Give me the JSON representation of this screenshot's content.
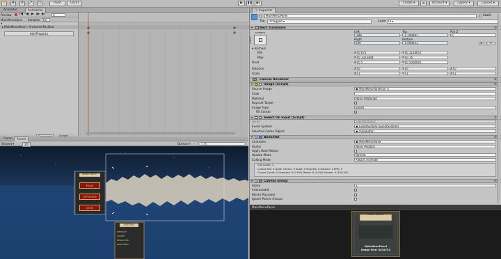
{
  "toolbar": {
    "pivot_label": "Pivot",
    "local_label": "Local",
    "collab_label": "Collab",
    "account_label": "Account",
    "layers_label": "Layers",
    "layout_label": "Layout"
  },
  "animation": {
    "tab_animator": "Animator",
    "tab_animation": "Animation",
    "preview_label": "Preview",
    "frame_value": "0",
    "clip_name": "MainMenuOpen",
    "samples_label": "Samples",
    "samples_value": "60",
    "property_label": "MainMenuPanel : Anchored Position",
    "add_property_label": "Add Property",
    "bottom_tab_dopesheet": "Dopesheet",
    "bottom_tab_curves": "Curves"
  },
  "scene": {
    "tab_game": "Game",
    "tab_scene": "Scene",
    "shaded_label": "Shaded",
    "mode_2d": "2D",
    "gizmos_label": "Gizmos",
    "search_placeholder": "All",
    "menu_title": "MAIN MENU",
    "play_label": "PLAY",
    "options_label": "OPTIONS",
    "quit_label": "QUIT",
    "options_title": "OPTIONS",
    "opt_row1": "DIFFICULTY",
    "opt_row2": "VOLUME",
    "opt_row3": "RESOLUTION",
    "opt_row4": "BRIGHTNESS"
  },
  "inspector": {
    "tab_label": "Inspector",
    "object_name": "MainMenuPanel",
    "static_label": "Static",
    "tag_label": "Tag",
    "tag_value": "Untagged",
    "layer_label": "Layer",
    "layer_value": "UI",
    "rect_transform": {
      "title": "Rect Transform",
      "anchor_label": "custom",
      "side_label": "custom",
      "left_label": "Left",
      "left_value": "-646",
      "top_label": "Top",
      "top_value": "-1.199981",
      "posz_label": "Pos Z",
      "posz_value": "0",
      "right_label": "Right",
      "right_value": "646",
      "bottom_label": "Bottom",
      "bottom_value": "-1.000031",
      "r_button": "R",
      "anchors_label": "Anchors",
      "min_label": "Min",
      "min_x": "0.075",
      "min_y": "0.1124057",
      "max_label": "Max",
      "max_x": "0.3323404",
      "max_y": "0.74",
      "pivot_label": "Pivot",
      "pivot_x": "0.5",
      "pivot_y": "0.5000001",
      "rotation_label": "Rotation",
      "rot_x": "0",
      "rot_y": "0",
      "rot_z": "0",
      "scale_label": "Scale",
      "scale_x": "1",
      "scale_y": "1",
      "scale_z": "1"
    },
    "canvas_renderer": {
      "title": "Canvas Renderer"
    },
    "image": {
      "title": "Image (Script)",
      "source_label": "Source Image",
      "source_value": "MainMenuPanelFull_4",
      "color_label": "Color",
      "material_label": "Material",
      "material_value": "None (Material)",
      "raycast_label": "Raycast Target",
      "type_label": "Image Type",
      "type_value": "Sliced",
      "fill_label": "Fill Center"
    },
    "select_on_input": {
      "title": "Select On Input (Script)",
      "script_label": "Script",
      "script_value": "SelectOnInput",
      "eventsystem_label": "Event System",
      "eventsystem_value": "EventSystem (EventSystem)",
      "selected_label": "Selected Game Object",
      "selected_value": "PlayButton"
    },
    "animator": {
      "title": "Animator",
      "controller_label": "Controller",
      "controller_value": "MainMenuPanel",
      "avatar_label": "Avatar",
      "avatar_value": "None (Avatar)",
      "rootmotion_label": "Apply Root Motion",
      "update_label": "Update Mode",
      "update_value": "Normal",
      "culling_label": "Culling Mode",
      "culling_value": "Always Animate",
      "info_line1": "Clip Count: 2",
      "info_line2": "Curves Pos: 0 Quat: 0 Euler: 0 Scale: 0 Muscles: 0 Generic: 4 PPtr: 0",
      "info_line3": "Curves Count: 4 Constant: 0 (0.0%) Dense: 0 (0.0%) Stream: 4 (100.0%)"
    },
    "canvas_group": {
      "title": "Canvas Group",
      "alpha_label": "Alpha",
      "alpha_value": "1",
      "interactable_label": "Interactable",
      "blocks_label": "Blocks Raycasts",
      "ignore_label": "Ignore Parent Groups"
    },
    "preview": {
      "tab_label": "MainMenuPanel",
      "banner_text": "MAIN MENU",
      "caption_line1": "MainMenuPanel",
      "caption_line2": "Image Size: 843x723"
    }
  },
  "colors": {
    "accent": "#3d6fc4",
    "scene_bg": "#1d3a63",
    "preview_bg": "#1f1f1f",
    "menu_button": "#8b1610"
  }
}
